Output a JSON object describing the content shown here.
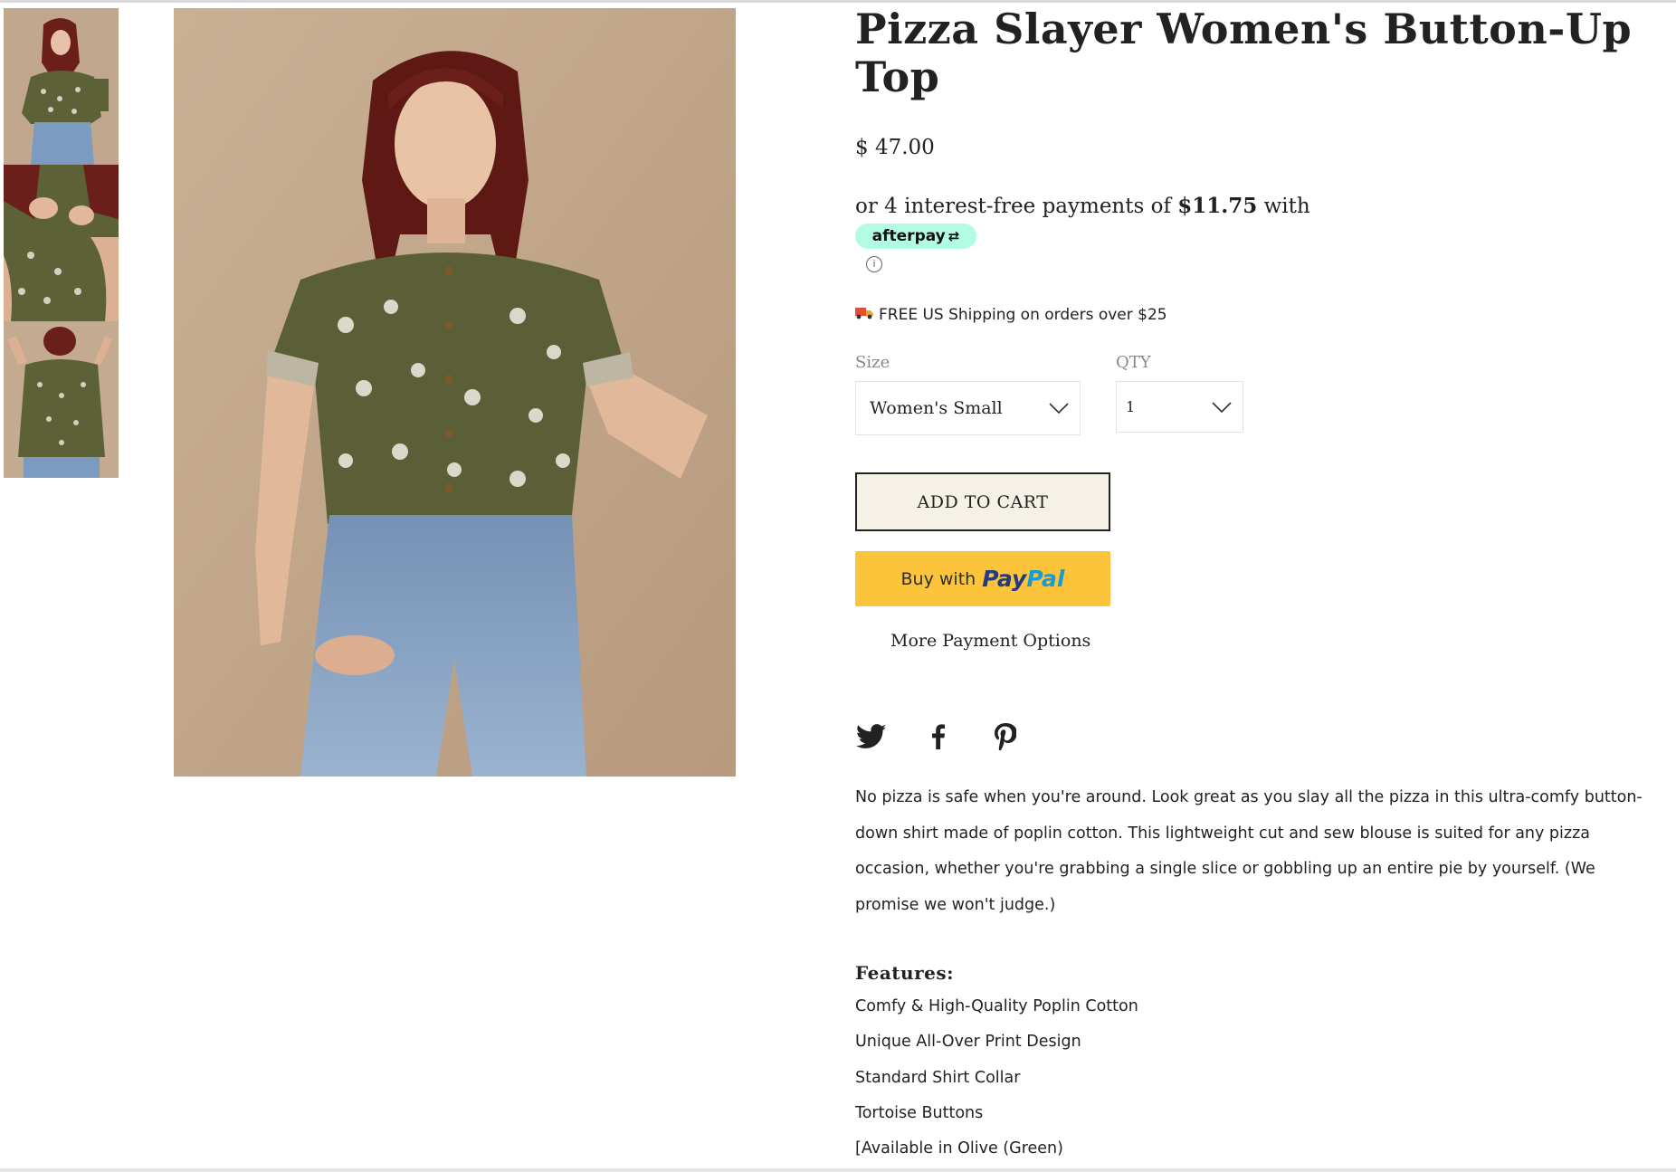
{
  "product": {
    "title": "Pizza Slayer Women's Button-Up Top",
    "price": "$ 47.00",
    "afterpay": {
      "prefix": "or 4 interest-free payments of ",
      "amount": "$11.75",
      "suffix": " with",
      "brand": "afterpay",
      "info_icon": "info-icon"
    },
    "shipping": "FREE US Shipping on orders over $25",
    "size": {
      "label": "Size",
      "selected": "Women's Small"
    },
    "qty": {
      "label": "QTY",
      "selected": "1"
    },
    "add_to_cart": "ADD TO CART",
    "paypal": {
      "buy": "Buy with",
      "pay": "Pay",
      "pal": "Pal"
    },
    "more_payment": "More Payment Options",
    "social": [
      "twitter-icon",
      "facebook-icon",
      "pinterest-icon"
    ],
    "description": "No pizza is safe when you're around. Look great as you slay all the pizza in this ultra-comfy button-down shirt made of poplin cotton. This lightweight cut and sew blouse is suited for any pizza occasion, whether you're grabbing a single slice or gobbling up an entire pie by yourself. (We promise we won't judge.)",
    "features_title": "Features:",
    "features": [
      "Comfy & High-Quality Poplin Cotton",
      "Unique All-Over Print Design",
      "Standard Shirt Collar",
      "Tortoise Buttons",
      "[Available in Olive (Green)"
    ]
  },
  "colors": {
    "afterpay_mint": "#b2fce4",
    "paypal_yellow": "#fbc43a",
    "paypal_navy": "#253b80",
    "paypal_blue": "#179bd7",
    "cart_button_bg": "#f5f1e6"
  }
}
